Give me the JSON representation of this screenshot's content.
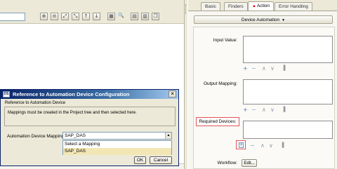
{
  "tabs": {
    "items": [
      {
        "label": "Basic"
      },
      {
        "label": "Finders"
      },
      {
        "label": "Action",
        "warning_icon": "warning-triangle-icon"
      },
      {
        "label": "Error Handling"
      }
    ],
    "active": "Action"
  },
  "action_panel": {
    "automation_button": "Device Automation",
    "input_value_label": "Input Value:",
    "output_mapping_label": "Output Mapping:",
    "required_devices_label": "Required Devices:",
    "workflow_label": "Workflow:",
    "edit_button": "Edit...",
    "tool_icons": [
      "add-icon",
      "remove-icon",
      "move-up-icon",
      "move-down-icon",
      "grip-icon"
    ]
  },
  "toolbar": {
    "icons": [
      "zoom-in-icon",
      "zoom-out-icon",
      "zoom-fit-icon",
      "zoom-actual-icon",
      "arrow-up-icon",
      "arrow-down-icon",
      "grid-icon",
      "search-icon",
      "layout-icon",
      "layout-alt-icon",
      "restore-icon"
    ]
  },
  "dialog": {
    "title": "Reference to Automation Device Configuration",
    "app_icon_label": "DS",
    "group_label": "Reference to Automation Device",
    "message": "Mappings must be created in the Project tree and then selected here.",
    "mapping_label": "Automation Device Mapping:",
    "selected_value": "SAP_DAS",
    "options": [
      "Select a Mapping",
      "SAP_DAS"
    ],
    "ok_label": "OK",
    "cancel_label": "Cancel"
  },
  "colors": {
    "title_bar": "#0a246a",
    "highlight_border": "#e15555",
    "selected_option": "#f2e6b4"
  }
}
